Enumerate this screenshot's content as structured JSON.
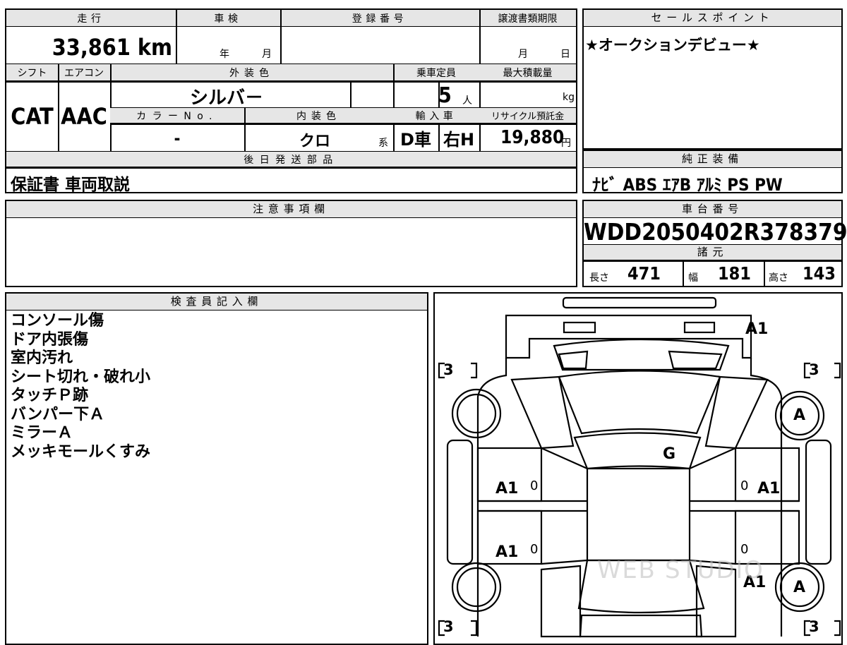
{
  "vehicle": {
    "mileage_label": "走行",
    "mileage_value": "33,861",
    "mileage_unit": "km",
    "inspection_label": "車検",
    "inspection_year": "年",
    "inspection_month": "月",
    "registration_label": "登録番号",
    "registration_value": "",
    "transfer_label": "譲渡書類期限",
    "transfer_month": "月",
    "transfer_day": "日",
    "shift_label": "シフト",
    "shift_value": "CAT",
    "ac_label": "エアコン",
    "ac_value": "AAC",
    "exterior_label": "外装色",
    "exterior_value": "シルバ－",
    "seating_label": "乗車定員",
    "seating_value": "5",
    "seating_unit": "人",
    "maxload_label": "最大積載量",
    "maxload_unit": "kg",
    "color_no_label": "カラーNo.",
    "color_no_value": "-",
    "interior_label": "内装色",
    "interior_value": "クロ",
    "interior_suffix": "系",
    "import_label": "輸入車",
    "import_value": "D車",
    "handle_value": "右H",
    "recycle_label": "リサイクル預託金",
    "recycle_value": "19,880",
    "recycle_unit": "円",
    "later_parts_label": "後日発送部品",
    "later_parts_value": "保証書 車両取説"
  },
  "sales_point": {
    "label": "セールスポイント",
    "text": "★オークションデビュー★"
  },
  "genuine_equipment": {
    "label": "純正装備",
    "text": "ﾅﾋﾞ ABS ｴｱB ｱﾙﾐ PS PW"
  },
  "caution": {
    "label": "注意事項欄",
    "text": ""
  },
  "chassis": {
    "label": "車台番号",
    "number": "WDD2050402R378379",
    "specs_label": "諸元",
    "length_label": "長さ",
    "length_value": "471",
    "width_label": "幅",
    "width_value": "181",
    "height_label": "高さ",
    "height_value": "143"
  },
  "inspector": {
    "label": "検査員記入欄",
    "notes": [
      "コンソール傷",
      "ドア内張傷",
      "室内汚れ",
      "シート切れ・破れ小",
      "タッチＰ跡",
      "バンパー下Ａ",
      "ミラーＡ",
      "メッキモールくすみ"
    ]
  },
  "diagram": {
    "tire_bracket_fl": "3",
    "tire_bracket_fr": "3",
    "tire_bracket_rl": "3",
    "tire_bracket_rr": "3",
    "front_bumper": "A1",
    "wheel_fr": "A",
    "wheel_rr": "A",
    "windshield": "G",
    "door_fl": "A1",
    "door_fr": "A1",
    "door_rl": "A1",
    "quarter_rr": "A1",
    "door_fl_meter": "0",
    "door_fr_meter": "0",
    "door_rl_meter": "0",
    "door_rr_meter": "0",
    "watermark": "WEB STUDIO"
  }
}
